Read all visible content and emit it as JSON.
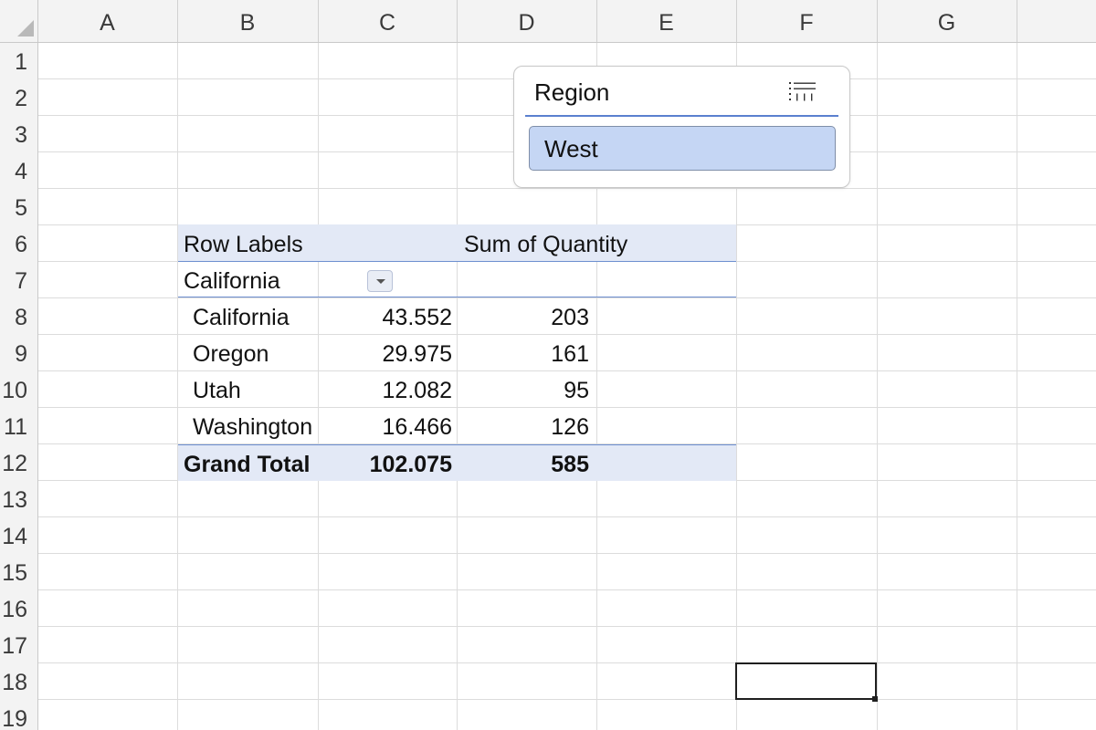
{
  "columns": [
    "A",
    "B",
    "C",
    "D",
    "E",
    "F",
    "G"
  ],
  "rows": [
    "1",
    "2",
    "3",
    "4",
    "5",
    "6",
    "7",
    "8",
    "9",
    "10",
    "11",
    "12",
    "13",
    "14",
    "15",
    "16",
    "17",
    "18",
    "19"
  ],
  "slicer": {
    "title": "Region",
    "icon": "multi-select-icon",
    "selected_item": "West"
  },
  "pivot": {
    "header": {
      "row_labels": "Row Labels",
      "sum_of_quantity": "Sum of Quantity"
    },
    "filter_row": {
      "label": "California",
      "icon": "dropdown-arrow-icon"
    },
    "rows": [
      {
        "label": "California",
        "value1": "43.552",
        "value2": "203"
      },
      {
        "label": "Oregon",
        "value1": "29.975",
        "value2": "161"
      },
      {
        "label": "Utah",
        "value1": "12.082",
        "value2": "95"
      },
      {
        "label": "Washington",
        "value1": "16.466",
        "value2": "126"
      }
    ],
    "grand_total": {
      "label": "Grand Total",
      "value1": "102.075",
      "value2": "585"
    }
  },
  "active_cell": "F18"
}
